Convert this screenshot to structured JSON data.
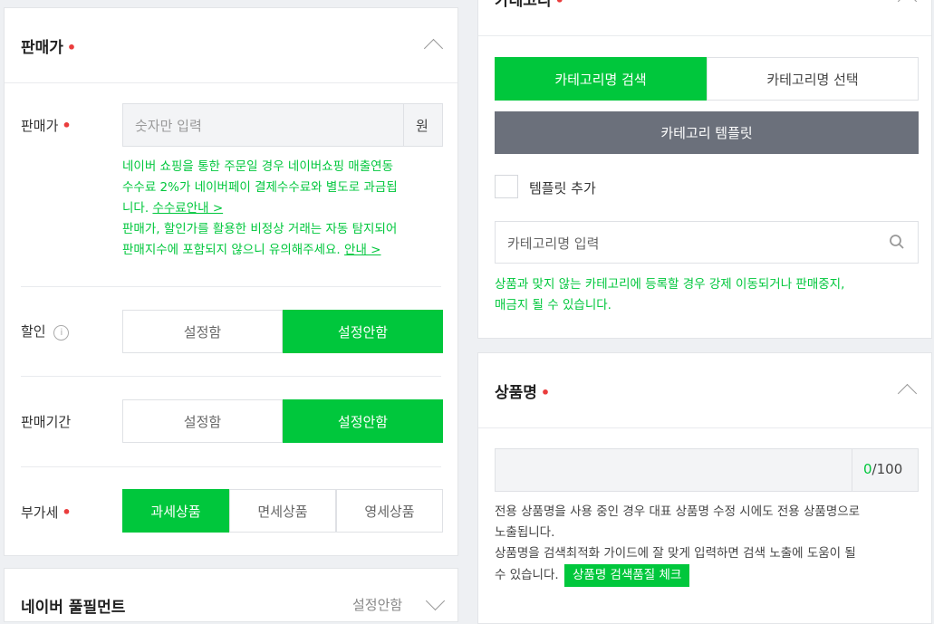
{
  "left": {
    "section_title": "판매가",
    "price_label": "판매가",
    "price_placeholder": "숫자만 입력",
    "price_unit": "원",
    "notice_line1": "네이버 쇼핑을 통한 주문일 경우 네이버쇼핑 매출연동",
    "notice_line2": "수수료 2%가 네이버페이 결제수수료와 별도로 과금됩",
    "notice_line3_prefix": "니다.",
    "notice_link1": "수수료안내 >",
    "notice_line4": "판매가, 할인가를 활용한 비정상 거래는 자동 탐지되어",
    "notice_line5_prefix": "판매지수에 포함되지 않으니 유의해주세요.",
    "notice_link2": "안내 >",
    "discount_label": "할인",
    "discount_info_icon": "i",
    "discount_options": [
      "설정함",
      "설정안함"
    ],
    "period_label": "판매기간",
    "period_options": [
      "설정함",
      "설정안함"
    ],
    "vat_label": "부가세",
    "vat_options": [
      "과세상품",
      "면세상품",
      "영세상품"
    ],
    "next_section_title": "네이버 풀필먼트",
    "next_section_status": "설정안함"
  },
  "right": {
    "category_title": "카테고리",
    "category_tabs": [
      "카테고리명 검색",
      "카테고리명 선택"
    ],
    "template_button": "카테고리 템플릿",
    "template_checkbox_label": "템플릿 추가",
    "category_placeholder": "카테고리명 입력",
    "category_notice_line1": "상품과 맞지 않는 카테고리에 등록할 경우 강제 이동되거나 판매중지,",
    "category_notice_line2": "매금지 될 수 있습니다.",
    "name_title": "상품명",
    "name_count_current": "0",
    "name_count_max": "/100",
    "name_notice_line1": "전용 상품명을 사용 중인 경우 대표 상품명 수정 시에도 전용 상품명으로",
    "name_notice_line2": "노출됩니다.",
    "name_notice_line3": "상품명을 검색최적화 가이드에 잘 맞게 입력하면 검색 노출에 도움이 될",
    "name_notice_line4": "수 있습니다.",
    "name_check_button": "상품명 검색품질 체크"
  },
  "colors": {
    "accent": "#00c73c",
    "required": "#ea3c3c",
    "template_btn": "#6b707b"
  }
}
